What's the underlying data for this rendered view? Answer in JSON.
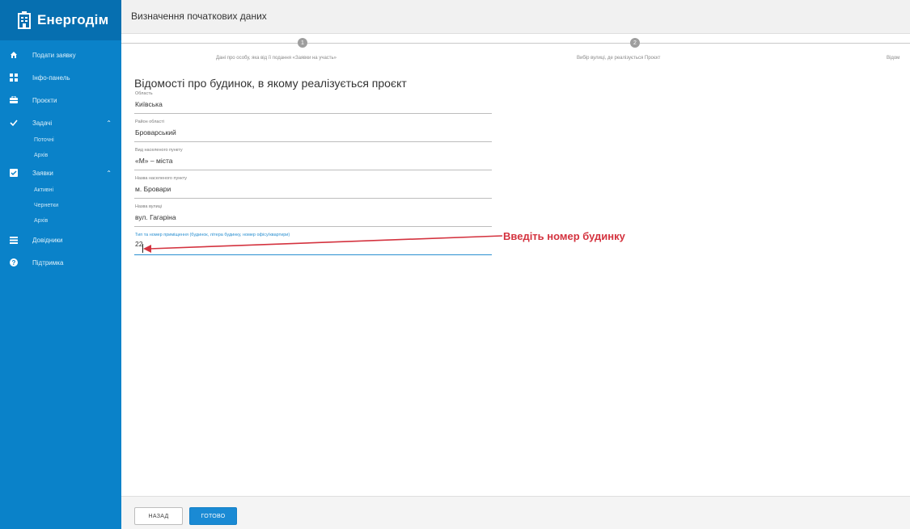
{
  "brand": {
    "name": "Енергодім"
  },
  "sidebar": {
    "items": [
      {
        "label": "Подати заявку",
        "icon": "home-icon"
      },
      {
        "label": "Інфо-панель",
        "icon": "dashboard-icon"
      },
      {
        "label": "Проєкти",
        "icon": "briefcase-icon"
      },
      {
        "label": "Задачі",
        "icon": "checkmark-icon",
        "sub": [
          "Поточні",
          "Архів"
        ]
      },
      {
        "label": "Заявки",
        "icon": "checkbox-icon",
        "sub": [
          "Активні",
          "Чернетки",
          "Архів"
        ]
      },
      {
        "label": "Довідники",
        "icon": "list-icon"
      },
      {
        "label": "Підтримка",
        "icon": "help-icon"
      }
    ]
  },
  "header": {
    "title": "Визначення початкових даних"
  },
  "steps": [
    {
      "number": "1",
      "label": "Дані про особу, яка від її подання «Заявки на участь»"
    },
    {
      "number": "2",
      "label": "Вибір вулиці, де реалізується Проєкт"
    },
    {
      "label": "Відом"
    }
  ],
  "form": {
    "title": "Відомості про будинок, в якому реалізується проєкт",
    "fields": [
      {
        "label": "Область",
        "value": "Київська"
      },
      {
        "label": "Район області",
        "value": "Броварський"
      },
      {
        "label": "Вид населеного пункту",
        "value": "«М» – міста"
      },
      {
        "label": "Назва населеного пункту",
        "value": "м. Бровари"
      },
      {
        "label": "Назва вулиці",
        "value": "вул. Гагаріна"
      },
      {
        "label": "Тип та номер приміщення (будинок, літера будинку, номер офісу/квартири)",
        "value": "22"
      }
    ]
  },
  "annotation": {
    "text": "Введіть номер будинку",
    "color": "#d4333f"
  },
  "footer": {
    "back_label": "НАЗАД",
    "done_label": "ГОТОВО"
  },
  "colors": {
    "sidebar": "#0a82c9",
    "brand_bg": "#066fb0",
    "accent": "#1a8ad4"
  }
}
